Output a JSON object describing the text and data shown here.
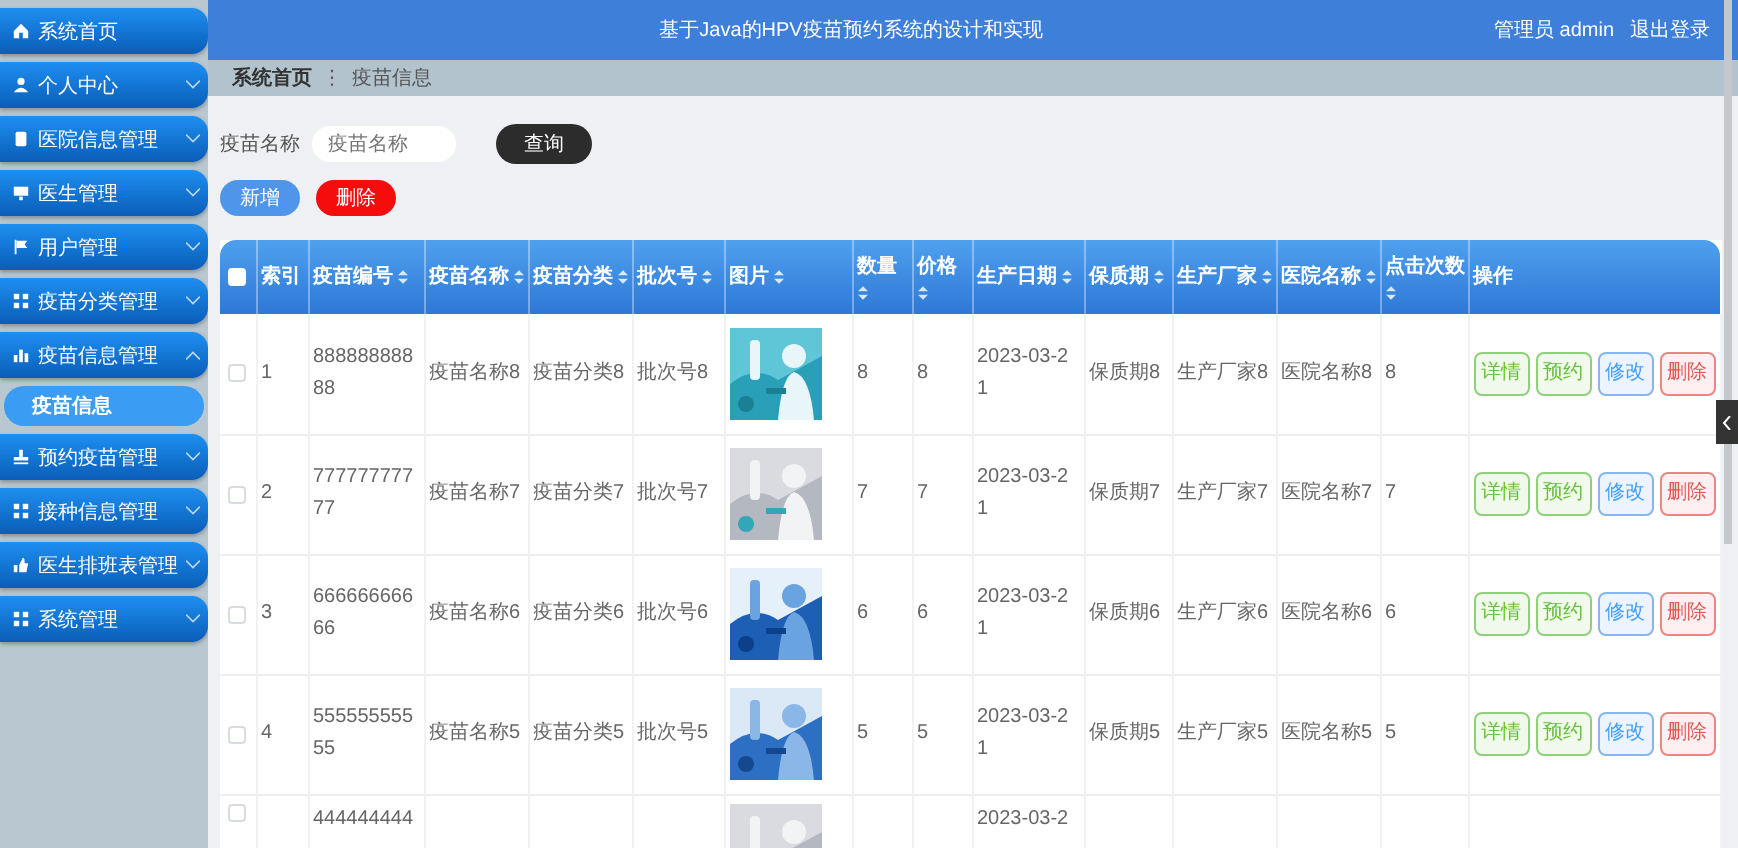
{
  "header": {
    "title": "基于Java的HPV疫苗预约系统的设计和实现",
    "user": "管理员 admin",
    "logout": "退出登录"
  },
  "sidebar": {
    "items": [
      {
        "label": "系统首页",
        "has_caret": false
      },
      {
        "label": "个人中心",
        "expanded": false,
        "has_caret": true
      },
      {
        "label": "医院信息管理",
        "expanded": false,
        "has_caret": true
      },
      {
        "label": "医生管理",
        "expanded": false,
        "has_caret": true
      },
      {
        "label": "用户管理",
        "expanded": false,
        "has_caret": true
      },
      {
        "label": "疫苗分类管理",
        "expanded": false,
        "has_caret": true
      },
      {
        "label": "疫苗信息管理",
        "expanded": true,
        "has_caret": true,
        "children": [
          {
            "label": "疫苗信息",
            "selected": true
          }
        ]
      },
      {
        "label": "预约疫苗管理",
        "expanded": false,
        "has_caret": true
      },
      {
        "label": "接种信息管理",
        "expanded": false,
        "has_caret": true
      },
      {
        "label": "医生排班表管理",
        "expanded": false,
        "has_caret": true
      },
      {
        "label": "系统管理",
        "expanded": false,
        "has_caret": true
      }
    ]
  },
  "breadcrumb": {
    "items": [
      "系统首页",
      "疫苗信息"
    ],
    "separator": "⋮"
  },
  "search": {
    "label": "疫苗名称",
    "placeholder": "疫苗名称",
    "button": "查询"
  },
  "toolbar": [
    {
      "label": "新增",
      "kind": "primary"
    },
    {
      "label": "删除",
      "kind": "danger"
    }
  ],
  "table": {
    "select_all": {
      "checked": false
    },
    "columns": [
      {
        "label": "索引",
        "sortable": false,
        "kind": "text"
      },
      {
        "label": "疫苗编号",
        "sortable": true,
        "kind": "text"
      },
      {
        "label": "疫苗名称",
        "sortable": true,
        "kind": "text"
      },
      {
        "label": "疫苗分类",
        "sortable": true,
        "kind": "text"
      },
      {
        "label": "批次号",
        "sortable": true,
        "kind": "text"
      },
      {
        "label": "图片",
        "sortable": true,
        "kind": "picture"
      },
      {
        "label": "数量",
        "sortable": true,
        "kind": "text"
      },
      {
        "label": "价格",
        "sortable": true,
        "kind": "text"
      },
      {
        "label": "生产日期",
        "sortable": true,
        "kind": "text"
      },
      {
        "label": "保质期",
        "sortable": true,
        "kind": "text"
      },
      {
        "label": "生产厂家",
        "sortable": true,
        "kind": "text"
      },
      {
        "label": "医院名称",
        "sortable": true,
        "kind": "text"
      },
      {
        "label": "点击次数",
        "sortable": true,
        "kind": "text"
      },
      {
        "label": "操作",
        "sortable": false,
        "kind": "actions"
      }
    ],
    "rows": [
      {
        "checked": false,
        "cells": [
          "1",
          "88888888888",
          "疫苗名称8",
          "疫苗分类8",
          "批次号8",
          {
            "kind": "picture"
          },
          "8",
          "8",
          "2023-03-21",
          "保质期8",
          "生产厂家8",
          "医院名称8",
          "8",
          [
            {
              "label": "详情",
              "kind": "success"
            },
            {
              "label": "预约",
              "kind": "success"
            },
            {
              "label": "修改",
              "kind": "primary"
            },
            {
              "label": "删除",
              "kind": "danger"
            }
          ]
        ]
      },
      {
        "checked": false,
        "cells": [
          "2",
          "77777777777",
          "疫苗名称7",
          "疫苗分类7",
          "批次号7",
          {
            "kind": "picture"
          },
          "7",
          "7",
          "2023-03-21",
          "保质期7",
          "生产厂家7",
          "医院名称7",
          "7",
          [
            {
              "label": "详情",
              "kind": "success"
            },
            {
              "label": "预约",
              "kind": "success"
            },
            {
              "label": "修改",
              "kind": "primary"
            },
            {
              "label": "删除",
              "kind": "danger"
            }
          ]
        ]
      },
      {
        "checked": false,
        "cells": [
          "3",
          "66666666666",
          "疫苗名称6",
          "疫苗分类6",
          "批次号6",
          {
            "kind": "picture"
          },
          "6",
          "6",
          "2023-03-21",
          "保质期6",
          "生产厂家6",
          "医院名称6",
          "6",
          [
            {
              "label": "详情",
              "kind": "success"
            },
            {
              "label": "预约",
              "kind": "success"
            },
            {
              "label": "修改",
              "kind": "primary"
            },
            {
              "label": "删除",
              "kind": "danger"
            }
          ]
        ]
      },
      {
        "checked": false,
        "cells": [
          "4",
          "55555555555",
          "疫苗名称5",
          "疫苗分类5",
          "批次号5",
          {
            "kind": "picture"
          },
          "5",
          "5",
          "2023-03-21",
          "保质期5",
          "生产厂家5",
          "医院名称5",
          "5",
          [
            {
              "label": "详情",
              "kind": "success"
            },
            {
              "label": "预约",
              "kind": "success"
            },
            {
              "label": "修改",
              "kind": "primary"
            },
            {
              "label": "删除",
              "kind": "danger"
            }
          ]
        ]
      },
      {
        "checked": false,
        "cells": [
          null,
          "444444444",
          null,
          null,
          null,
          {
            "kind": "picture"
          },
          null,
          null,
          "2023-03-2",
          null,
          null,
          null,
          null,
          null
        ]
      }
    ]
  }
}
